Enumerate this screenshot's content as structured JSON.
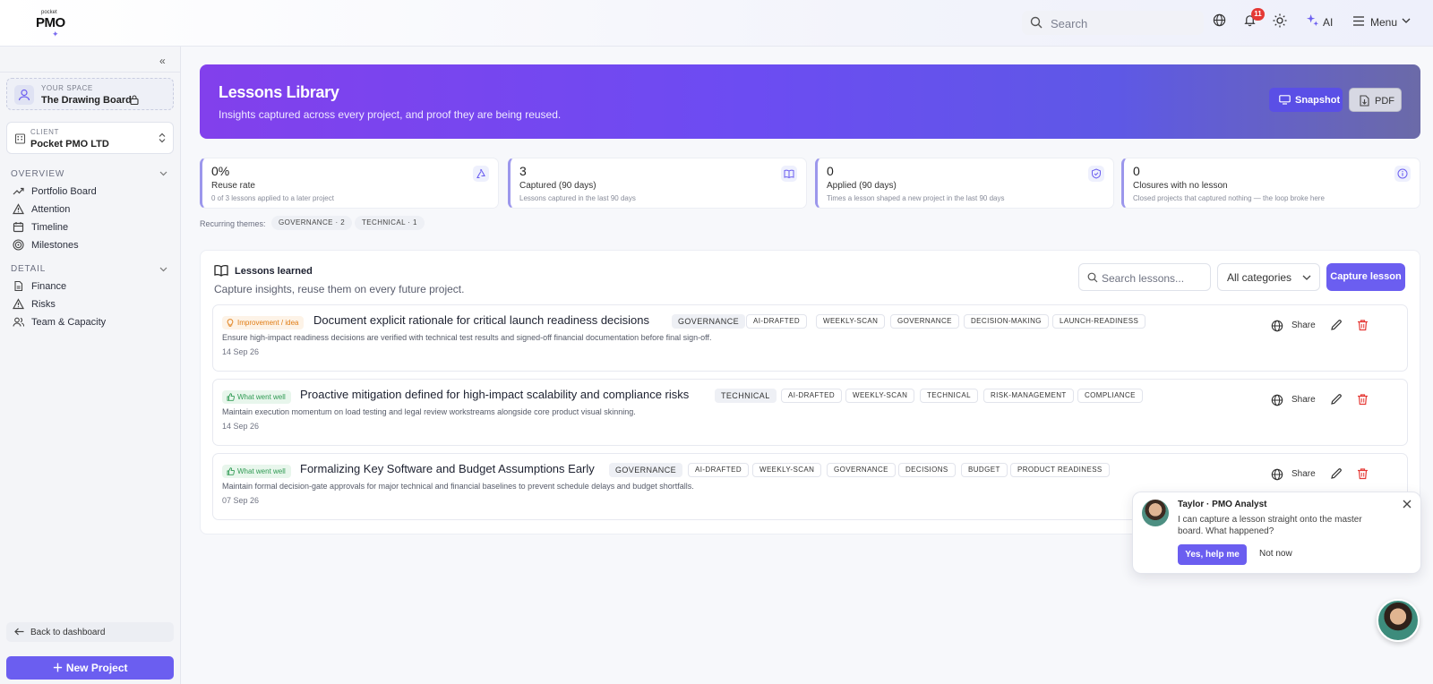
{
  "app": {
    "logo_small": "pocket",
    "logo_big": "PMO"
  },
  "topbar": {
    "search_placeholder": "Search",
    "notifications_count": "11",
    "ai_label": "AI",
    "menu_label": "Menu"
  },
  "sidebar": {
    "space_label": "YOUR SPACE",
    "space_name": "The Drawing Board",
    "client_label": "CLIENT",
    "client_name": "Pocket PMO LTD",
    "overview_title": "OVERVIEW",
    "overview_items": [
      "Portfolio Board",
      "Attention",
      "Timeline",
      "Milestones"
    ],
    "detail_title": "DETAIL",
    "detail_items": [
      "Finance",
      "Risks",
      "Team & Capacity"
    ],
    "back_label": "Back to dashboard",
    "new_project_label": "New Project"
  },
  "hero": {
    "title": "Lessons Library",
    "subtitle": "Insights captured across every project, and proof they are being reused.",
    "snapshot_label": "Snapshot",
    "pdf_label": "PDF"
  },
  "stats": [
    {
      "value": "0%",
      "title": "Reuse rate",
      "sub": "0 of 3 lessons applied to a later project"
    },
    {
      "value": "3",
      "title": "Captured (90 days)",
      "sub": "Lessons captured in the last 90 days"
    },
    {
      "value": "0",
      "title": "Applied (90 days)",
      "sub": "Times a lesson shaped a new project in the last 90 days"
    },
    {
      "value": "0",
      "title": "Closures with no lesson",
      "sub": "Closed projects that captured nothing — the loop broke here"
    }
  ],
  "themes": {
    "label": "Recurring themes:",
    "items": [
      "GOVERNANCE · 2",
      "TECHNICAL · 1"
    ]
  },
  "lessons_panel": {
    "title": "Lessons learned",
    "subtitle": "Capture insights, reuse them on every future project.",
    "search_placeholder": "Search lessons...",
    "category_selected": "All categories",
    "capture_label": "Capture lesson",
    "share_label": "Share"
  },
  "lessons": [
    {
      "type": "Improvement / idea",
      "title": "Document explicit rationale for critical launch readiness decisions",
      "category": "GOVERNANCE",
      "tags": [
        "AI-DRAFTED",
        "WEEKLY-SCAN",
        "GOVERNANCE",
        "DECISION-MAKING",
        "LAUNCH-READINESS"
      ],
      "description": "Ensure high-impact readiness decisions are verified with technical test results and signed-off financial documentation before final sign-off.",
      "date": "14 Sep 26"
    },
    {
      "type": "What went well",
      "title": "Proactive mitigation defined for high-impact scalability and compliance risks",
      "category": "TECHNICAL",
      "tags": [
        "AI-DRAFTED",
        "WEEKLY-SCAN",
        "TECHNICAL",
        "RISK-MANAGEMENT",
        "COMPLIANCE"
      ],
      "description": "Maintain execution momentum on load testing and legal review workstreams alongside core product visual skinning.",
      "date": "14 Sep 26"
    },
    {
      "type": "What went well",
      "title": "Formalizing Key Software and Budget Assumptions Early",
      "category": "GOVERNANCE",
      "tags": [
        "AI-DRAFTED",
        "WEEKLY-SCAN",
        "GOVERNANCE",
        "DECISIONS",
        "BUDGET",
        "PRODUCT READINESS"
      ],
      "description": "Maintain formal decision-gate approvals for major technical and financial baselines to prevent schedule delays and budget shortfalls.",
      "date": "07 Sep 26"
    }
  ],
  "assistant": {
    "name": "Taylor · PMO Analyst",
    "message": "I can capture a lesson straight onto the master board. What happened?",
    "yes_label": "Yes, help me",
    "no_label": "Not now"
  },
  "colors": {
    "accent": "#6b5ef0",
    "danger": "#e53935",
    "idea": "#e07c14",
    "well": "#2f9a53"
  }
}
